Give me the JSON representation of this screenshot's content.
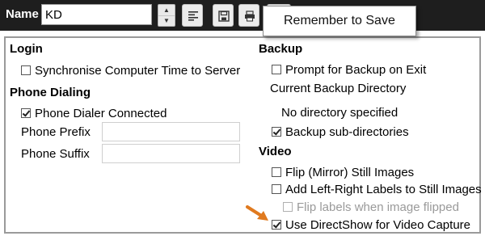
{
  "header": {
    "name_label": "Name",
    "name_value": "KD",
    "spin_up": "▲",
    "spin_down": "▼"
  },
  "tooltip": {
    "text": "Remember to Save"
  },
  "login": {
    "title": "Login",
    "sync_time": {
      "label": "Synchronise Computer Time to Server",
      "checked": false
    }
  },
  "phone": {
    "title": "Phone Dialing",
    "dialer_connected": {
      "label": "Phone Dialer Connected",
      "checked": true
    },
    "prefix_label": "Phone Prefix",
    "prefix_value": "",
    "suffix_label": "Phone Suffix",
    "suffix_value": ""
  },
  "backup": {
    "title": "Backup",
    "prompt_on_exit": {
      "label": "Prompt for Backup on Exit",
      "checked": false
    },
    "current_dir_label": "Current Backup Directory",
    "current_dir_value": "No directory specified",
    "subdirs": {
      "label": "Backup sub-directories",
      "checked": true
    }
  },
  "video": {
    "title": "Video",
    "flip_mirror": {
      "label": "Flip (Mirror) Still Images",
      "checked": false
    },
    "add_lr_labels": {
      "label": "Add Left-Right Labels to Still Images",
      "checked": false
    },
    "flip_labels": {
      "label": "Flip labels when image flipped",
      "checked": false,
      "disabled": true
    },
    "directshow": {
      "label": "Use DirectShow for Video Capture",
      "checked": true
    }
  },
  "colors": {
    "topbar": "#1e1e1e",
    "arrow": "#e07a1f",
    "panel_border": "#9a9a9a"
  }
}
